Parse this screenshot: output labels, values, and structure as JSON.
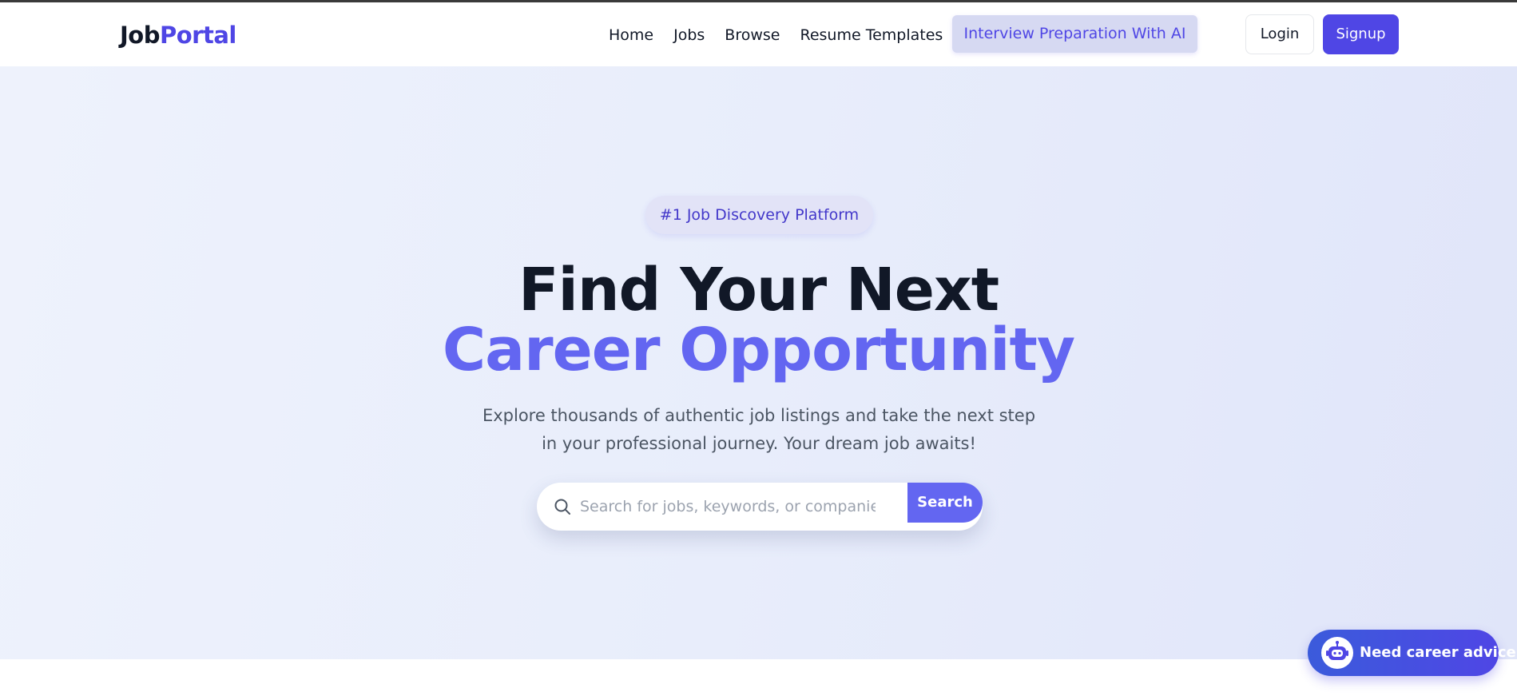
{
  "nav": {
    "logo_part1": "Job",
    "logo_part2": "Portal",
    "links": [
      "Home",
      "Jobs",
      "Browse",
      "Resume Templates"
    ],
    "ai_button": "Interview Preparation With AI",
    "login": "Login",
    "signup": "Signup"
  },
  "hero": {
    "badge": "#1 Job Discovery Platform",
    "title_line1": "Find Your Next",
    "title_line2": "Career Opportunity",
    "subtitle": "Explore thousands of authentic job listings and take the next step in your professional journey. Your dream job awaits!",
    "search": {
      "placeholder": "Search for jobs, keywords, or companies",
      "button": "Search"
    }
  },
  "chat": {
    "label": "Need career advice?"
  },
  "colors": {
    "brand": "#4f46e5",
    "accent": "#6366f1",
    "text_dark": "#111827"
  },
  "icons": {
    "search": "search-icon",
    "chat": "robot-icon"
  }
}
